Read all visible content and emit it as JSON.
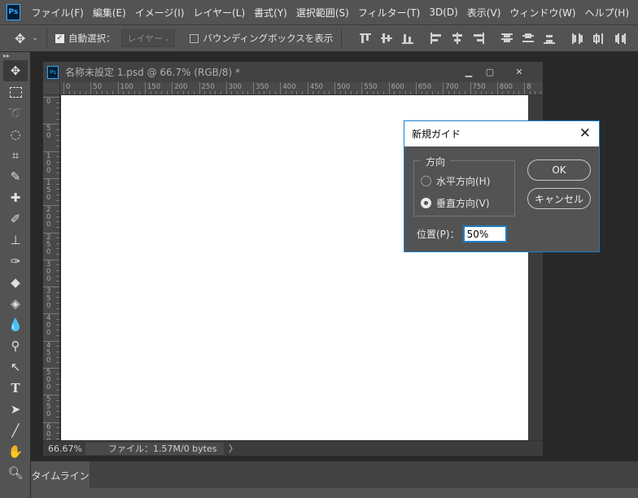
{
  "menubar": {
    "logo": "Ps",
    "items": [
      "ファイル(F)",
      "編集(E)",
      "イメージ(I)",
      "レイヤー(L)",
      "書式(Y)",
      "選択範囲(S)",
      "フィルター(T)",
      "3D(D)",
      "表示(V)",
      "ウィンドウ(W)",
      "ヘルプ(H)"
    ]
  },
  "options": {
    "auto_select_label": "自動選択：",
    "auto_select_checked": true,
    "layer_select_value": "レイヤー",
    "bounding_box_label": "バウンディングボックスを表示",
    "bounding_box_checked": false
  },
  "document": {
    "title": "名称未設定 1.psd @ 66.7% (RGB/8) *",
    "ruler_top_labels": [
      "0",
      "50",
      "100",
      "150",
      "200",
      "250",
      "300",
      "350",
      "400",
      "450",
      "500",
      "550",
      "600",
      "650",
      "700",
      "750",
      "800",
      "8"
    ],
    "ruler_left_labels": [
      "0",
      "5\n0",
      "1\n0\n0",
      "1\n5\n0",
      "2\n0\n0",
      "2\n5\n0",
      "3\n0\n0",
      "3\n5\n0",
      "4\n0\n0",
      "4\n5\n0",
      "5\n0\n0",
      "5\n5\n0",
      "6\n0\n0"
    ],
    "status_zoom": "66.67%",
    "status_info": "ファイル：1.57M/0 bytes"
  },
  "timeline": {
    "tab_label": "タイムライン"
  },
  "dialog": {
    "title": "新規ガイド",
    "group_label": "方向",
    "radio_horizontal": "水平方向(H)",
    "radio_vertical": "垂直方向(V)",
    "selected": "vertical",
    "ok_label": "OK",
    "cancel_label": "キャンセル",
    "position_label": "位置(P)：",
    "position_value": "50%"
  }
}
